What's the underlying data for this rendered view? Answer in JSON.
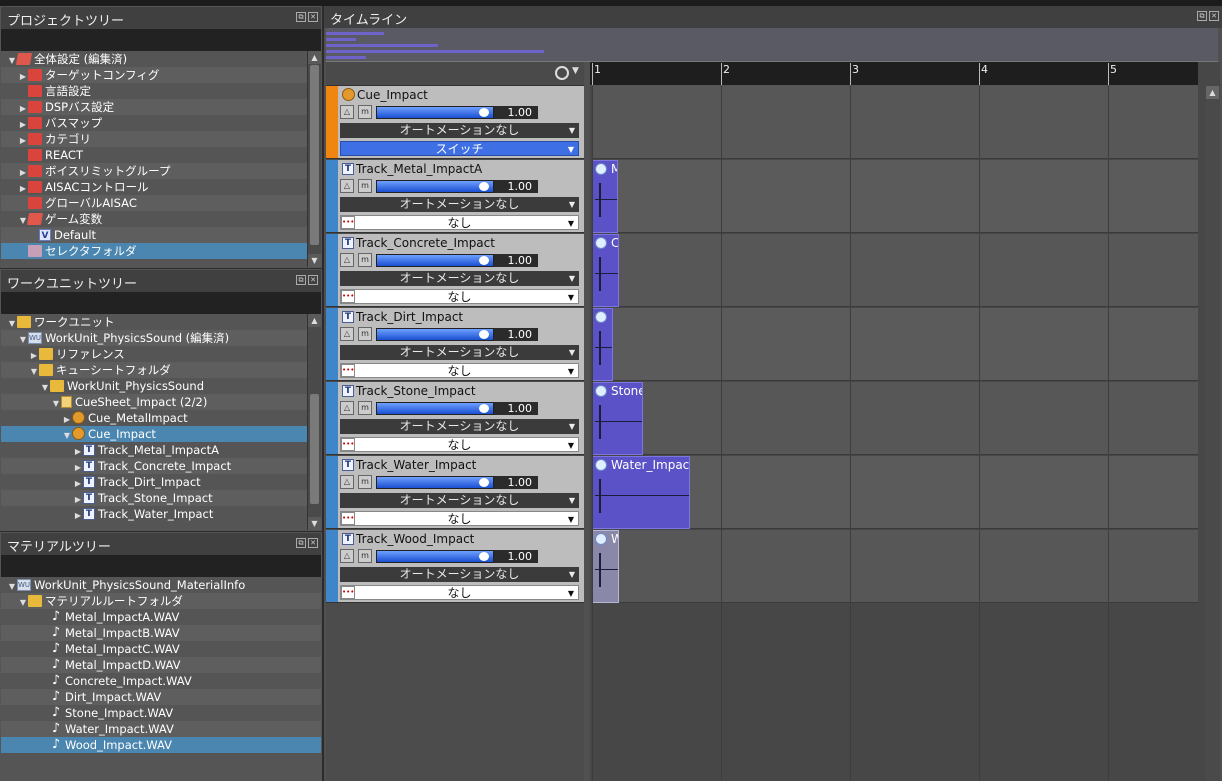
{
  "project_tree": {
    "title": "プロジェクトツリー",
    "items": [
      {
        "label": "全体設定 (編集済)",
        "depth": 0,
        "arrow": "▼",
        "icon": "folder-red-open"
      },
      {
        "label": "ターゲットコンフィグ",
        "depth": 1,
        "arrow": "▶",
        "icon": "folder-red"
      },
      {
        "label": "言語設定",
        "depth": 1,
        "arrow": "",
        "icon": "folder-red"
      },
      {
        "label": "DSPバス設定",
        "depth": 1,
        "arrow": "▶",
        "icon": "folder-red"
      },
      {
        "label": "バスマップ",
        "depth": 1,
        "arrow": "▶",
        "icon": "folder-red"
      },
      {
        "label": "カテゴリ",
        "depth": 1,
        "arrow": "▶",
        "icon": "folder-red"
      },
      {
        "label": "REACT",
        "depth": 1,
        "arrow": "",
        "icon": "folder-red"
      },
      {
        "label": "ボイスリミットグループ",
        "depth": 1,
        "arrow": "▶",
        "icon": "folder-red"
      },
      {
        "label": "AISACコントロール",
        "depth": 1,
        "arrow": "▶",
        "icon": "folder-red"
      },
      {
        "label": "グローバルAISAC",
        "depth": 1,
        "arrow": "",
        "icon": "folder-red"
      },
      {
        "label": "ゲーム変数",
        "depth": 1,
        "arrow": "▼",
        "icon": "folder-red-open"
      },
      {
        "label": "Default",
        "depth": 2,
        "arrow": "",
        "icon": "v"
      },
      {
        "label": "セレクタフォルダ",
        "depth": 1,
        "arrow": "",
        "icon": "folder-pink",
        "selected": true
      }
    ]
  },
  "workunit_tree": {
    "title": "ワークユニットツリー",
    "items": [
      {
        "label": "ワークユニット",
        "depth": 0,
        "arrow": "▼",
        "icon": "folder-yel"
      },
      {
        "label": "WorkUnit_PhysicsSound (編集済)",
        "depth": 1,
        "arrow": "▼",
        "icon": "wu"
      },
      {
        "label": "リファレンス",
        "depth": 2,
        "arrow": "▶",
        "icon": "folder-yel"
      },
      {
        "label": "キューシートフォルダ",
        "depth": 2,
        "arrow": "▼",
        "icon": "folder-yel"
      },
      {
        "label": "WorkUnit_PhysicsSound",
        "depth": 3,
        "arrow": "▼",
        "icon": "folder-yel"
      },
      {
        "label": "CueSheet_Impact (2/2)",
        "depth": 4,
        "arrow": "▼",
        "icon": "sheet"
      },
      {
        "label": "Cue_MetalImpact",
        "depth": 5,
        "arrow": "▶",
        "icon": "cue"
      },
      {
        "label": "Cue_Impact",
        "depth": 5,
        "arrow": "▼",
        "icon": "cue",
        "selected": true
      },
      {
        "label": "Track_Metal_ImpactA",
        "depth": 6,
        "arrow": "▶",
        "icon": "t"
      },
      {
        "label": "Track_Concrete_Impact",
        "depth": 6,
        "arrow": "▶",
        "icon": "t"
      },
      {
        "label": "Track_Dirt_Impact",
        "depth": 6,
        "arrow": "▶",
        "icon": "t"
      },
      {
        "label": "Track_Stone_Impact",
        "depth": 6,
        "arrow": "▶",
        "icon": "t"
      },
      {
        "label": "Track_Water_Impact",
        "depth": 6,
        "arrow": "▶",
        "icon": "t"
      }
    ]
  },
  "material_tree": {
    "title": "マテリアルツリー",
    "items": [
      {
        "label": "WorkUnit_PhysicsSound_MaterialInfo",
        "depth": 0,
        "arrow": "▼",
        "icon": "wu"
      },
      {
        "label": "マテリアルルートフォルダ",
        "depth": 1,
        "arrow": "▼",
        "icon": "folder-yel"
      },
      {
        "label": "Metal_ImpactA.WAV",
        "depth": 3,
        "arrow": "",
        "icon": "note"
      },
      {
        "label": "Metal_ImpactB.WAV",
        "depth": 3,
        "arrow": "",
        "icon": "note"
      },
      {
        "label": "Metal_ImpactC.WAV",
        "depth": 3,
        "arrow": "",
        "icon": "note"
      },
      {
        "label": "Metal_ImpactD.WAV",
        "depth": 3,
        "arrow": "",
        "icon": "note"
      },
      {
        "label": "Concrete_Impact.WAV",
        "depth": 3,
        "arrow": "",
        "icon": "note"
      },
      {
        "label": "Dirt_Impact.WAV",
        "depth": 3,
        "arrow": "",
        "icon": "note"
      },
      {
        "label": "Stone_Impact.WAV",
        "depth": 3,
        "arrow": "",
        "icon": "note"
      },
      {
        "label": "Water_Impact.WAV",
        "depth": 3,
        "arrow": "",
        "icon": "note"
      },
      {
        "label": "Wood_Impact.WAV",
        "depth": 3,
        "arrow": "",
        "icon": "note",
        "selected": true
      }
    ]
  },
  "timeline": {
    "title": "タイムライン",
    "ruler": [
      "1",
      "2",
      "3",
      "4",
      "5"
    ],
    "tracks": [
      {
        "name": "Cue_Impact",
        "kind": "cue",
        "volume": "1.00",
        "automation": "オートメーションなし",
        "selector": "スイッチ",
        "block_label": "",
        "block_len": 0,
        "light": false
      },
      {
        "name": "Track_Metal_ImpactA",
        "kind": "track",
        "volume": "1.00",
        "automation": "オートメーションなし",
        "selector": "なし",
        "block_label": "M",
        "block_len": 26,
        "light": false
      },
      {
        "name": "Track_Concrete_Impact",
        "kind": "track",
        "volume": "1.00",
        "automation": "オートメーションなし",
        "selector": "なし",
        "block_label": "C",
        "block_len": 27,
        "light": false
      },
      {
        "name": "Track_Dirt_Impact",
        "kind": "track",
        "volume": "1.00",
        "automation": "オートメーションなし",
        "selector": "なし",
        "block_label": "",
        "block_len": 21,
        "light": false
      },
      {
        "name": "Track_Stone_Impact",
        "kind": "track",
        "volume": "1.00",
        "automation": "オートメーションなし",
        "selector": "なし",
        "block_label": "Stone",
        "block_len": 51,
        "light": false
      },
      {
        "name": "Track_Water_Impact",
        "kind": "track",
        "volume": "1.00",
        "automation": "オートメーションなし",
        "selector": "なし",
        "block_label": "Water_Impact",
        "block_len": 98,
        "light": false
      },
      {
        "name": "Track_Wood_Impact",
        "kind": "track",
        "volume": "1.00",
        "automation": "オートメーションなし",
        "selector": "なし",
        "block_label": "W",
        "block_len": 27,
        "light": true
      }
    ]
  }
}
